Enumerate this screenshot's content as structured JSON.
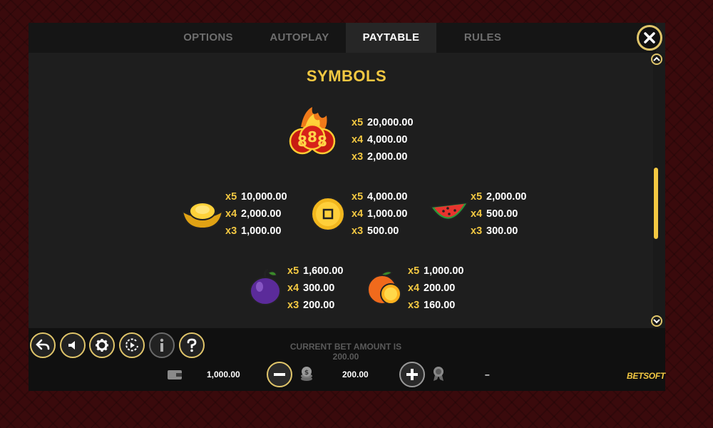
{
  "tabs": [
    {
      "label": "OPTIONS",
      "active": false
    },
    {
      "label": "AUTOPLAY",
      "active": false
    },
    {
      "label": "PAYTABLE",
      "active": true
    },
    {
      "label": "RULES",
      "active": false
    }
  ],
  "section_title": "SYMBOLS",
  "symbols": [
    {
      "icon": "888-coins-icon",
      "pays": [
        {
          "m": "x5",
          "v": "20,000.00"
        },
        {
          "m": "x4",
          "v": "4,000.00"
        },
        {
          "m": "x3",
          "v": "2,000.00"
        }
      ]
    },
    {
      "icon": "gold-ingot-icon",
      "pays": [
        {
          "m": "x5",
          "v": "10,000.00"
        },
        {
          "m": "x4",
          "v": "2,000.00"
        },
        {
          "m": "x3",
          "v": "1,000.00"
        }
      ]
    },
    {
      "icon": "gold-coin-icon",
      "pays": [
        {
          "m": "x5",
          "v": "4,000.00"
        },
        {
          "m": "x4",
          "v": "1,000.00"
        },
        {
          "m": "x3",
          "v": "500.00"
        }
      ]
    },
    {
      "icon": "watermelon-icon",
      "pays": [
        {
          "m": "x5",
          "v": "2,000.00"
        },
        {
          "m": "x4",
          "v": "500.00"
        },
        {
          "m": "x3",
          "v": "300.00"
        }
      ]
    },
    {
      "icon": "plum-icon",
      "pays": [
        {
          "m": "x5",
          "v": "1,600.00"
        },
        {
          "m": "x4",
          "v": "300.00"
        },
        {
          "m": "x3",
          "v": "200.00"
        }
      ]
    },
    {
      "icon": "orange-icon",
      "pays": [
        {
          "m": "x5",
          "v": "1,000.00"
        },
        {
          "m": "x4",
          "v": "200.00"
        },
        {
          "m": "x3",
          "v": "160.00"
        }
      ]
    }
  ],
  "bottom": {
    "bet_message": "CURRENT BET AMOUNT IS 200.00",
    "balance": "1,000.00",
    "bet": "200.00",
    "win": "–",
    "brand": "BETSOFT"
  },
  "colors": {
    "accent": "#f3c842",
    "panel": "#1c1c1c",
    "background": "#3a0a0c"
  }
}
